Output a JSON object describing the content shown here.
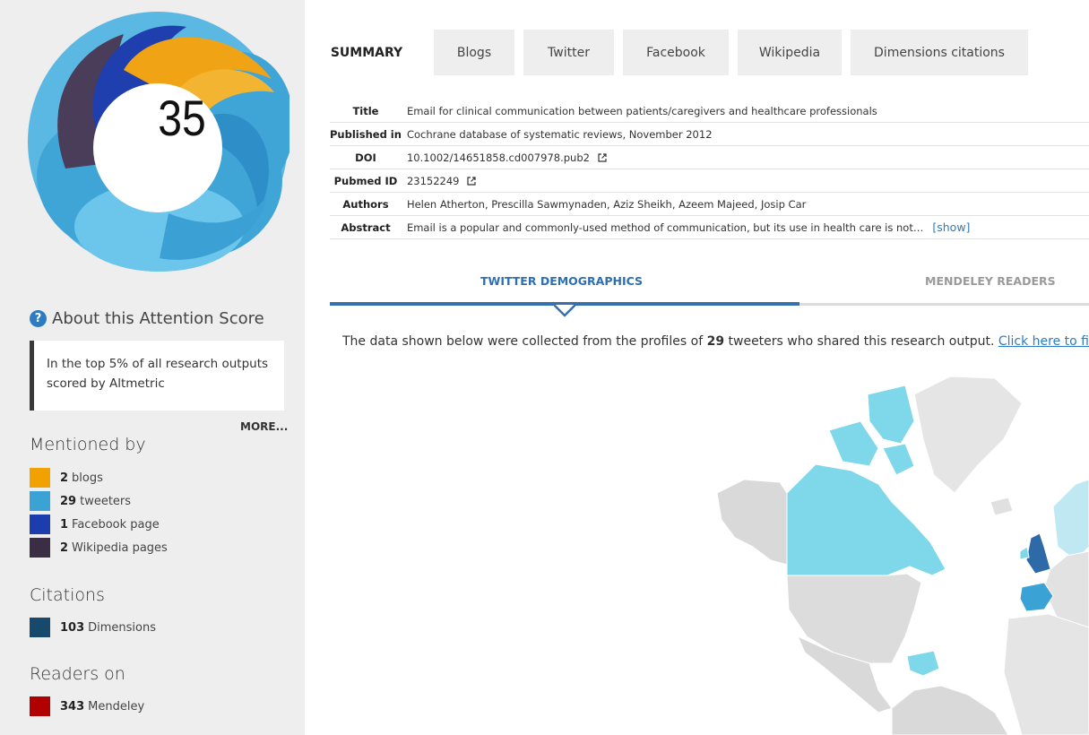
{
  "badge": {
    "score": "35",
    "colors": {
      "blogs": "#f1a100",
      "tweeters": "#3aa2d4",
      "facebook": "#1b3dad",
      "wikipedia": "#3b2d44"
    }
  },
  "sidebar": {
    "about_label": "About this Attention Score",
    "about_icon": "question-circle-icon",
    "top_text": "In the top 5% of all research outputs scored by Altmetric",
    "more_label": "MORE...",
    "mentioned_heading": "Mentioned by",
    "mentions": [
      {
        "count": "2",
        "label": "blogs",
        "color": "#f1a100"
      },
      {
        "count": "29",
        "label": "tweeters",
        "color": "#3aa2d4"
      },
      {
        "count": "1",
        "label": "Facebook page",
        "color": "#1b3dad"
      },
      {
        "count": "2",
        "label": "Wikipedia pages",
        "color": "#3b2d44"
      }
    ],
    "citations_heading": "Citations",
    "citations": [
      {
        "count": "103",
        "label": "Dimensions",
        "color": "#17496c"
      }
    ],
    "readers_heading": "Readers on",
    "readers": [
      {
        "count": "343",
        "label": "Mendeley",
        "color": "#b00000"
      }
    ]
  },
  "tabs": [
    "SUMMARY",
    "Blogs",
    "Twitter",
    "Facebook",
    "Wikipedia",
    "Dimensions citations"
  ],
  "meta": [
    {
      "key": "Title",
      "value": "Email for clinical communication between patients/caregivers and healthcare professionals"
    },
    {
      "key": "Published in",
      "value": "Cochrane database of systematic reviews, November 2012"
    },
    {
      "key": "DOI",
      "value": "10.1002/14651858.cd007978.pub2"
    },
    {
      "key": "Pubmed ID",
      "value": "23152249"
    },
    {
      "key": "Authors",
      "value": "Helen Atherton, Prescilla Sawmynaden, Aziz Sheikh, Azeem Majeed, Josip Car"
    },
    {
      "key": "Abstract",
      "value": "Email is a popular and commonly-used method of communication, but its use in health care is not…"
    }
  ],
  "show_link": "[show]",
  "demographics": {
    "tab_twitter": "TWITTER DEMOGRAPHICS",
    "tab_mendeley": "MENDELEY READERS",
    "text_before": "The data shown below were collected from the profiles of ",
    "count": "29",
    "text_after": " tweeters who shared this research output. ",
    "link": "Click here to fi"
  }
}
